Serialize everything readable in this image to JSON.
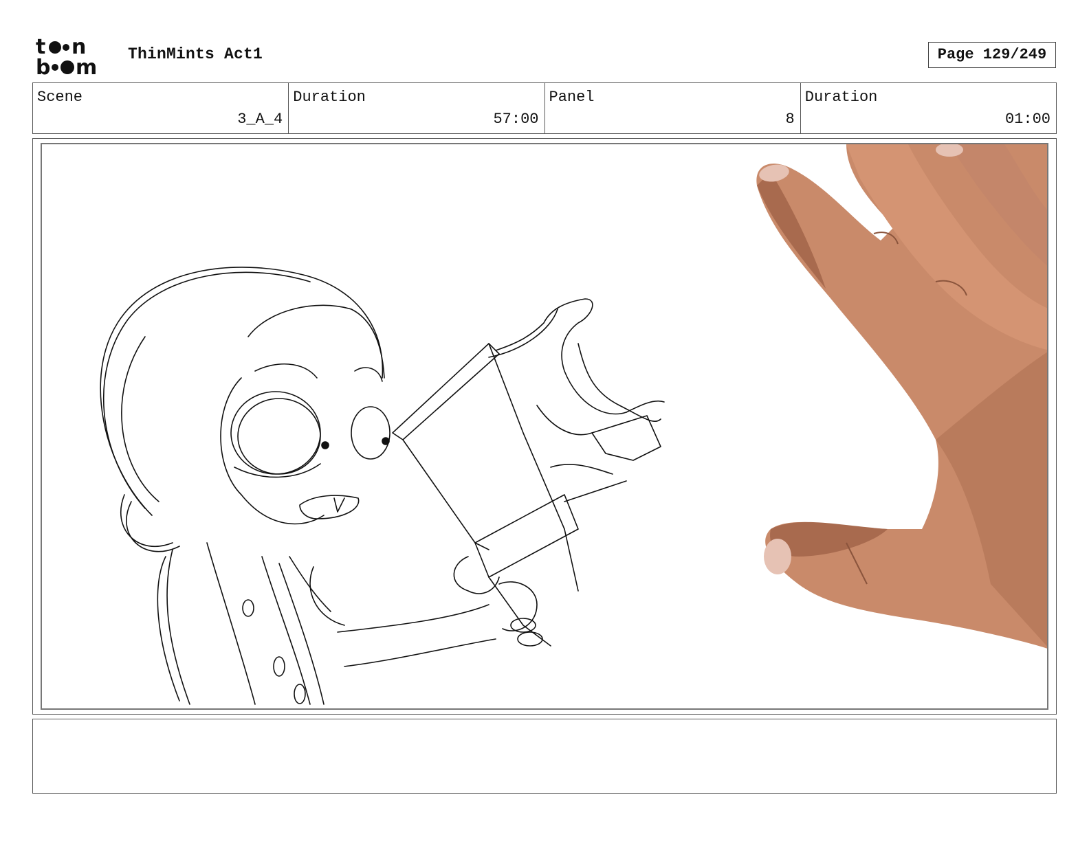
{
  "header": {
    "logo_text": "toon boom",
    "doc_title": "ThinMints Act1",
    "page_label": "Page 129/249"
  },
  "info": {
    "scene_label": "Scene",
    "scene_value": "3_A_4",
    "scene_duration_label": "Duration",
    "scene_duration_value": "57:00",
    "panel_label": "Panel",
    "panel_value": "8",
    "panel_duration_label": "Duration",
    "panel_duration_value": "01:00"
  },
  "notes": {
    "text": ""
  },
  "colors": {
    "skin": "#c98a6a",
    "skin_shadow": "#a86a4e",
    "nail": "#e6c2b4",
    "sketch_line": "#111111",
    "border": "#555555"
  }
}
